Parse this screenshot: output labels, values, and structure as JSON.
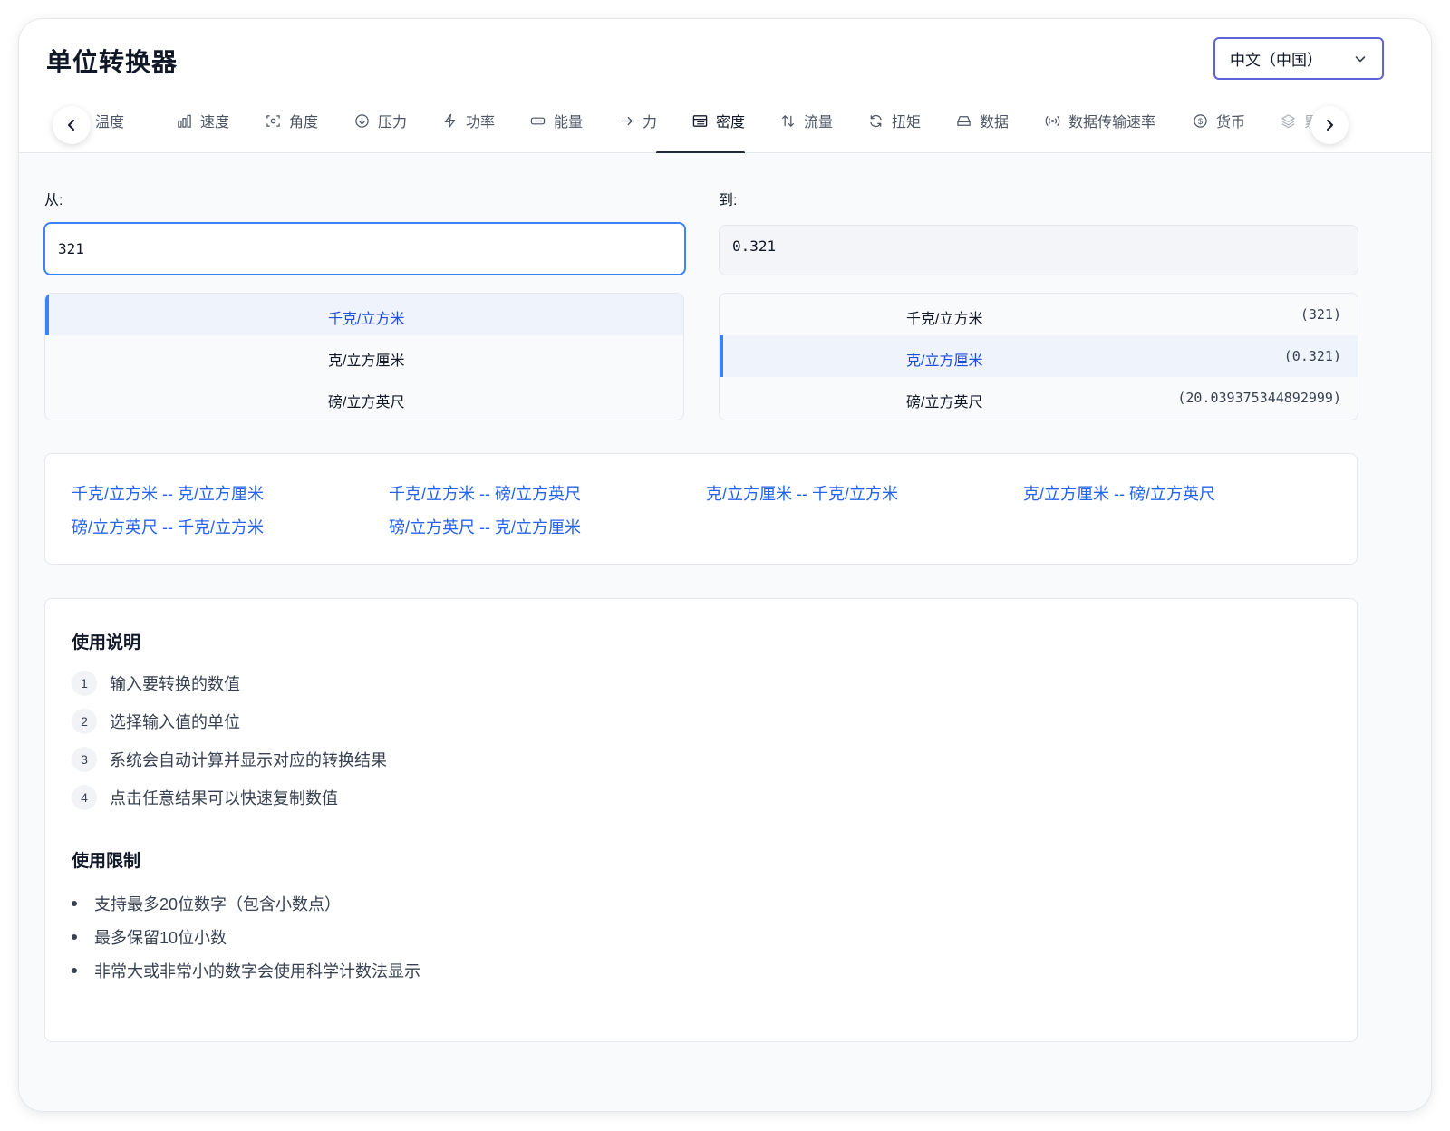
{
  "app": {
    "title": "单位转换器",
    "language": "中文（中国）"
  },
  "tabs": [
    {
      "label": "温度",
      "icon": "thermometer-icon"
    },
    {
      "label": "速度",
      "icon": "bar-chart-icon"
    },
    {
      "label": "角度",
      "icon": "focus-icon"
    },
    {
      "label": "压力",
      "icon": "arrow-down-circle-icon"
    },
    {
      "label": "功率",
      "icon": "bolt-icon"
    },
    {
      "label": "能量",
      "icon": "battery-icon"
    },
    {
      "label": "力",
      "icon": "arrow-right-icon"
    },
    {
      "label": "密度",
      "icon": "table-icon",
      "active": true
    },
    {
      "label": "流量",
      "icon": "swap-vertical-icon"
    },
    {
      "label": "扭矩",
      "icon": "refresh-icon"
    },
    {
      "label": "数据",
      "icon": "drive-icon"
    },
    {
      "label": "数据传输速率",
      "icon": "broadcast-icon"
    },
    {
      "label": "货币",
      "icon": "dollar-circle-icon"
    },
    {
      "label": "累",
      "icon": "layers-icon"
    }
  ],
  "from": {
    "label": "从:",
    "value": "321",
    "units": [
      "千克/立方米",
      "克/立方厘米",
      "磅/立方英尺"
    ],
    "selected_index": 0
  },
  "to": {
    "label": "到:",
    "value": "0.321",
    "units": [
      {
        "name": "千克/立方米",
        "value": "(321)"
      },
      {
        "name": "克/立方厘米",
        "value": "(0.321)"
      },
      {
        "name": "磅/立方英尺",
        "value": "(20.039375344892999)"
      }
    ],
    "selected_index": 1
  },
  "quick_links": [
    "千克/立方米 -- 克/立方厘米",
    "千克/立方米 -- 磅/立方英尺",
    "克/立方厘米 -- 千克/立方米",
    "克/立方厘米 -- 磅/立方英尺",
    "磅/立方英尺 -- 千克/立方米",
    "磅/立方英尺 -- 克/立方厘米"
  ],
  "instructions": {
    "title": "使用说明",
    "steps": [
      {
        "num": "1",
        "text": "输入要转换的数值"
      },
      {
        "num": "2",
        "text": "选择输入值的单位"
      },
      {
        "num": "3",
        "text": "系统会自动计算并显示对应的转换结果"
      },
      {
        "num": "4",
        "text": "点击任意结果可以快速复制数值"
      }
    ]
  },
  "limits": {
    "title": "使用限制",
    "items": [
      "支持最多20位数字（包含小数点）",
      "最多保留10位小数",
      "非常大或非常小的数字会使用科学计数法显示"
    ]
  },
  "colors": {
    "accent": "#3b82f6",
    "link": "#2563eb",
    "select_border": "#5b63d6"
  }
}
